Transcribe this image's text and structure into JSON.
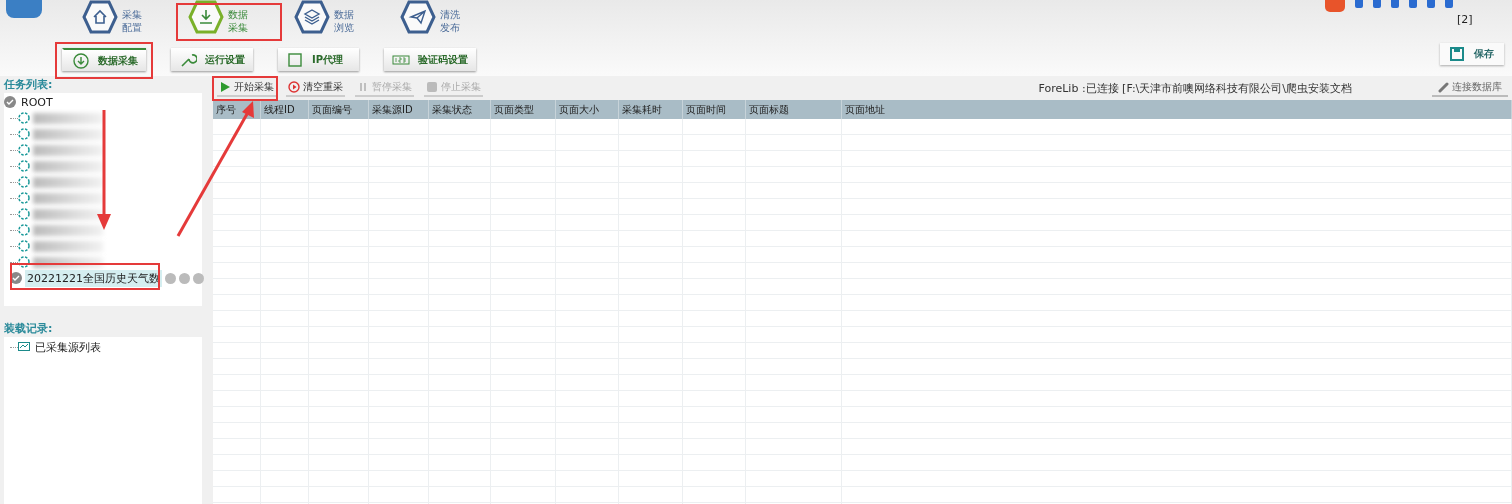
{
  "nav": [
    {
      "line1": "采集",
      "line2": "配置",
      "selected": false
    },
    {
      "line1": "数据",
      "line2": "采集",
      "selected": true
    },
    {
      "line1": "数据",
      "line2": "浏览",
      "selected": false
    },
    {
      "line1": "清洗",
      "line2": "发布",
      "selected": false
    }
  ],
  "tray_badge": "[2]",
  "subnav": [
    {
      "label": "数据采集",
      "selected": true
    },
    {
      "label": "运行设置",
      "selected": false
    },
    {
      "label": "IP代理",
      "selected": false
    },
    {
      "label": "验证码设置",
      "selected": false
    }
  ],
  "save_button": "保存",
  "task_list": {
    "title": "任务列表:",
    "root": {
      "label": "ROOT",
      "kind": "done",
      "selected": false,
      "children": [
        {
          "kind": "blurred",
          "selected": false
        },
        {
          "kind": "blurred",
          "selected": false
        },
        {
          "kind": "blurred",
          "selected": false
        },
        {
          "kind": "blurred",
          "selected": false
        },
        {
          "kind": "blurred",
          "selected": false
        },
        {
          "kind": "blurred",
          "selected": false
        },
        {
          "kind": "blurred",
          "selected": false
        },
        {
          "kind": "blurred",
          "selected": false
        },
        {
          "kind": "blurred",
          "selected": false
        },
        {
          "kind": "blurred",
          "selected": false
        },
        {
          "label": "20221221全国历史天气数",
          "kind": "done",
          "selected": true
        }
      ]
    }
  },
  "load_records": {
    "title": "装载记录:",
    "items": [
      {
        "label": "已采集源列表"
      }
    ]
  },
  "toolbar": [
    {
      "label": "开始采集",
      "disabled": false
    },
    {
      "label": "清空重采",
      "disabled": false
    },
    {
      "label": "暂停采集",
      "disabled": true
    },
    {
      "label": "停止采集",
      "disabled": true
    }
  ],
  "status": "ForeLib :已连接 [F:\\天津市前噢网络科技有限公司\\爬虫安装文档",
  "connect_db": "连接数据库",
  "table": {
    "columns": [
      "序号",
      "线程ID",
      "页面编号",
      "采集源ID",
      "采集状态",
      "页面类型",
      "页面大小",
      "采集耗时",
      "页面时间",
      "页面标题",
      "页面地址"
    ]
  }
}
